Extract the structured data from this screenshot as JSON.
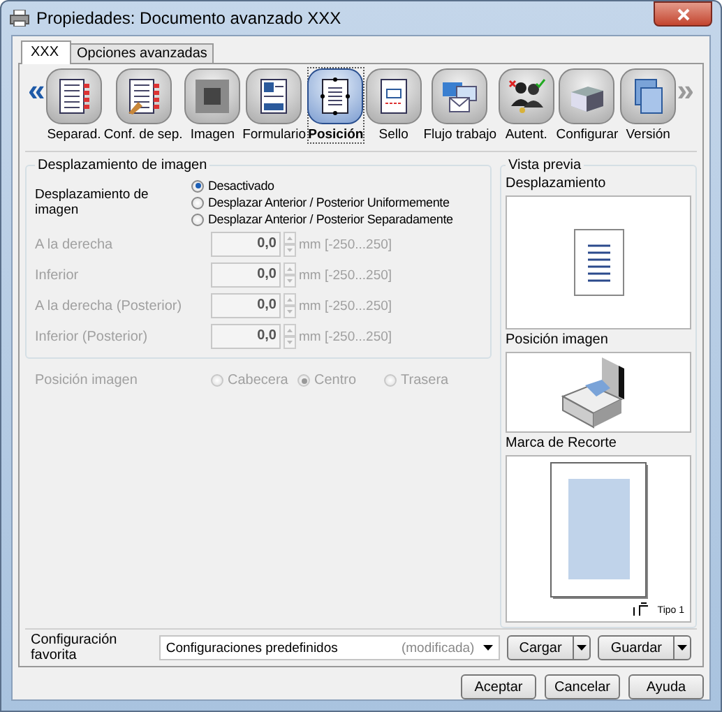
{
  "window": {
    "title": "Propiedades: Documento avanzado XXX"
  },
  "tabs": [
    {
      "label": "XXX",
      "selected": true
    },
    {
      "label": "Opciones avanzadas",
      "selected": false
    }
  ],
  "toolbar": {
    "scroll_left": {
      "glyph": "«",
      "disabled": false
    },
    "scroll_right": {
      "glyph": "»",
      "disabled": true
    },
    "items": [
      {
        "label": "Separad.",
        "kind": "separator",
        "selected": false
      },
      {
        "label": "Conf. de sep.",
        "kind": "separator-setup",
        "selected": false
      },
      {
        "label": "Imagen",
        "kind": "image",
        "selected": false
      },
      {
        "label": "Formulario",
        "kind": "form",
        "selected": false
      },
      {
        "label": "Posición",
        "kind": "position",
        "selected": true
      },
      {
        "label": "Sello",
        "kind": "stamp",
        "selected": false
      },
      {
        "label": "Flujo trabajo",
        "kind": "workflow",
        "selected": false
      },
      {
        "label": "Autent.",
        "kind": "auth",
        "selected": false
      },
      {
        "label": "Configurar",
        "kind": "device",
        "selected": false
      },
      {
        "label": "Versión",
        "kind": "version",
        "selected": false
      }
    ]
  },
  "image_shift": {
    "title": "Desplazamiento de imagen",
    "label": "Desplazamiento de imagen",
    "options": [
      {
        "label": "Desactivado",
        "selected": true
      },
      {
        "label": "Desplazar Anterior / Posterior Uniformemente",
        "selected": false
      },
      {
        "label": "Desplazar Anterior / Posterior Separadamente",
        "selected": false
      }
    ],
    "offsets": [
      {
        "label": "A la derecha",
        "value": "0,0",
        "range": "mm [-250...250]",
        "disabled": true
      },
      {
        "label": "Inferior",
        "value": "0,0",
        "range": "mm [-250...250]",
        "disabled": true
      },
      {
        "label": "A la derecha (Posterior)",
        "value": "0,0",
        "range": "mm [-250...250]",
        "disabled": true
      },
      {
        "label": "Inferior (Posterior)",
        "value": "0,0",
        "range": "mm [-250...250]",
        "disabled": true
      }
    ]
  },
  "image_position": {
    "label": "Posición imagen",
    "disabled": true,
    "options": [
      {
        "label": "Cabecera",
        "selected": false
      },
      {
        "label": "Centro",
        "selected": true
      },
      {
        "label": "Trasera",
        "selected": false
      }
    ]
  },
  "preview": {
    "title": "Vista previa",
    "panels": [
      {
        "label": "Desplazamiento",
        "kind": "page"
      },
      {
        "label": "Posición imagen",
        "kind": "device"
      },
      {
        "label": "Marca de Recorte",
        "kind": "crop",
        "caption": "Tipo 1"
      }
    ]
  },
  "favorite": {
    "label": "Configuración favorita",
    "value": "Configuraciones predefinidos",
    "status": "(modificada)",
    "buttons": [
      "Cargar",
      "Guardar"
    ]
  },
  "buttons": [
    "Aceptar",
    "Cancelar",
    "Ayuda"
  ]
}
